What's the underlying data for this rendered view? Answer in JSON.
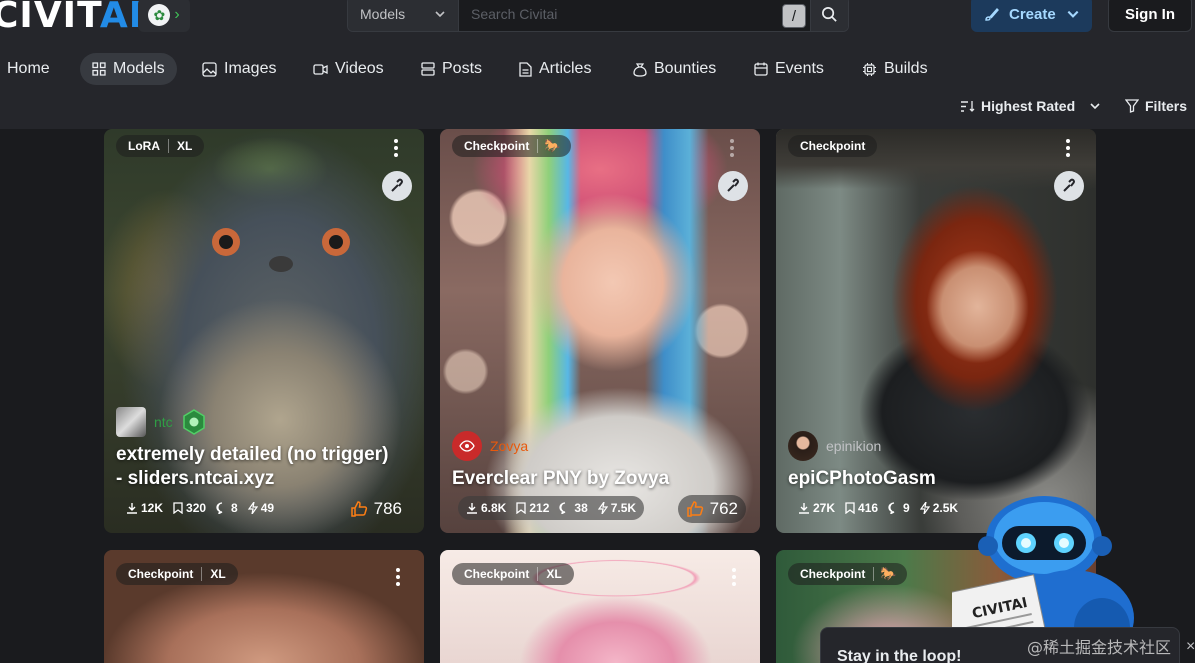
{
  "app": {
    "logo_main": "CIVIT",
    "logo_accent": "AI"
  },
  "search": {
    "scope": "Models",
    "placeholder": "Search Civitai",
    "shortcut": "/"
  },
  "header": {
    "create_label": "Create",
    "signin_label": "Sign In"
  },
  "nav": {
    "items": [
      {
        "label": "Home",
        "icon": "home-icon"
      },
      {
        "label": "Models",
        "icon": "grid-icon",
        "active": true
      },
      {
        "label": "Images",
        "icon": "image-icon"
      },
      {
        "label": "Videos",
        "icon": "video-icon"
      },
      {
        "label": "Posts",
        "icon": "posts-icon"
      },
      {
        "label": "Articles",
        "icon": "article-icon"
      },
      {
        "label": "Bounties",
        "icon": "moneybag-icon"
      },
      {
        "label": "Events",
        "icon": "calendar-icon"
      },
      {
        "label": "Builds",
        "icon": "cpu-icon"
      }
    ]
  },
  "toolbar": {
    "sort_label": "Highest Rated",
    "filters_label": "Filters"
  },
  "cards": [
    {
      "badges": [
        "LoRA",
        "XL"
      ],
      "creator": "ntc",
      "title_line1": "extremely detailed (no trigger)",
      "title_line2": "- sliders.ntcai.xyz",
      "downloads": "12K",
      "bookmarks": "320",
      "comments": "8",
      "buzz": "49",
      "likes": "786"
    },
    {
      "badges": [
        "Checkpoint"
      ],
      "creator": "Zovya",
      "title_line1": "Everclear PNY by Zovya",
      "downloads": "6.8K",
      "bookmarks": "212",
      "comments": "38",
      "buzz": "7.5K",
      "likes": "762"
    },
    {
      "badges": [
        "Checkpoint"
      ],
      "creator": "epinikion",
      "title_line1": "epiCPhotoGasm",
      "downloads": "27K",
      "bookmarks": "416",
      "comments": "9",
      "buzz": "2.5K"
    },
    {
      "badges": [
        "Checkpoint",
        "XL"
      ]
    },
    {
      "badges": [
        "Checkpoint",
        "XL"
      ]
    },
    {
      "badges": [
        "Checkpoint"
      ]
    }
  ],
  "popup": {
    "text": "Stay in the loop!",
    "close": "×"
  },
  "watermark": "@稀土掘金技术社区",
  "colors": {
    "header_bg": "#25262b",
    "page_bg": "#1a1b1e",
    "accent": "#228be6",
    "like": "#fd7e14",
    "creator_green": "#2f9e44",
    "creator_orange": "#e8590c"
  }
}
